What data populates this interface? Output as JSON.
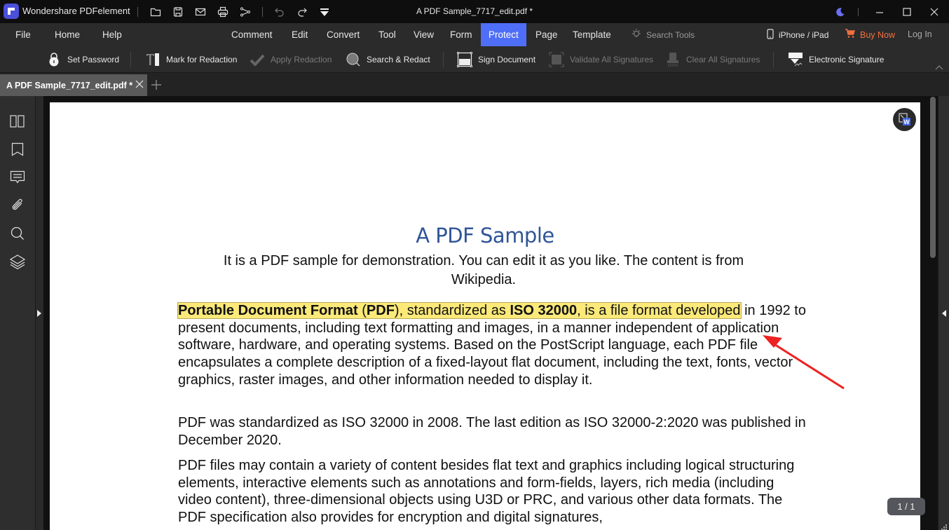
{
  "app": {
    "name": "Wondershare PDFelement",
    "document_title": "A PDF Sample_7717_edit.pdf *"
  },
  "quick_access": [
    "open-folder-icon",
    "save-icon",
    "email-icon",
    "print-icon",
    "share-icon",
    "undo-icon",
    "redo-icon",
    "customize-dropdown-icon"
  ],
  "window_controls": [
    "dark-mode-icon",
    "minimize-icon",
    "maximize-icon",
    "close-icon"
  ],
  "menu": {
    "left": [
      "File",
      "Home",
      "Help"
    ],
    "center": [
      "Comment",
      "Edit",
      "Convert",
      "Tool",
      "View",
      "Form",
      "Protect",
      "Page",
      "Template"
    ],
    "active": "Protect",
    "search_tools": "Search Tools",
    "iphone": "iPhone / iPad",
    "buy_now": "Buy Now",
    "login": "Log In"
  },
  "toolbar": {
    "set_password": "Set Password",
    "mark_redaction": "Mark for Redaction",
    "apply_redaction": "Apply Redaction",
    "search_redact": "Search & Redact",
    "sign_document": "Sign Document",
    "validate_signatures": "Validate All Signatures",
    "clear_signatures": "Clear All Signatures",
    "electronic_signature": "Electronic Signature"
  },
  "tabs": [
    {
      "label": "A PDF Sample_7717_edit.pdf *",
      "active": true
    }
  ],
  "sidebar": [
    "thumbnails-icon",
    "bookmark-icon",
    "comment-icon",
    "attachment-icon",
    "search-icon",
    "layers-icon"
  ],
  "document": {
    "title": "A PDF Sample",
    "subtitle": "It is a PDF sample for demonstration. You can edit it as you like. The content is from Wikipedia.",
    "p1": {
      "hl_bold1": "Portable Document Format",
      "hl_t1": " (",
      "hl_bold2": "PDF",
      "hl_t2": "), standardized as ",
      "hl_bold3": "ISO 32000",
      "hl_t3": ", is a file format developed",
      "rest": "in 1992 to present documents, including text formatting and images, in a manner independent of application software, hardware, and operating systems. Based on the PostScript language, each PDF file encapsulates a complete description of a fixed-layout flat document, including the text, fonts, vector graphics, raster images, and other information needed to display it."
    },
    "p2": "PDF was standardized as ISO 32000 in 2008. The last edition as ISO 32000-2:2020 was published in December 2020.",
    "p3": "PDF files may contain a variety of content besides flat text and graphics including logical structuring elements, interactive elements such as annotations and form-fields, layers, rich media (including video content), three-dimensional objects using U3D or PRC, and various other data formats. The PDF specification also provides for encryption and digital signatures,"
  },
  "page_indicator": "1 / 1",
  "colors": {
    "accent": "#4f6ef7",
    "buy_now": "#f07040",
    "highlight": "#fbe97a",
    "title_blue": "#2f5597",
    "annotation_arrow": "#ee2222"
  }
}
